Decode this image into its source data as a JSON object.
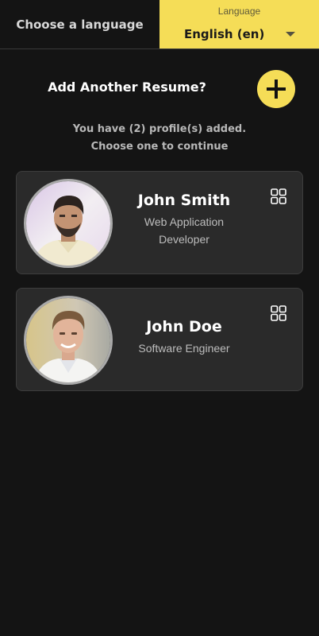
{
  "header": {
    "choose_label": "Choose a language",
    "language": {
      "caption": "Language",
      "selected": "English (en)"
    }
  },
  "add_section": {
    "title": "Add Another Resume?",
    "button_icon": "plus-icon"
  },
  "info": {
    "line1": "You have  (2) profile(s) added.",
    "line2": "Choose one to continue"
  },
  "profiles": [
    {
      "name": "John Smith",
      "role_line1": "Web Application",
      "role_line2": "Developer",
      "action_icon": "grid-icon"
    },
    {
      "name": "John Doe",
      "role_line1": "Software Engineer",
      "action_icon": "grid-icon"
    }
  ],
  "colors": {
    "accent": "#f5dd57",
    "background": "#141414",
    "card": "#2a2a2a"
  }
}
